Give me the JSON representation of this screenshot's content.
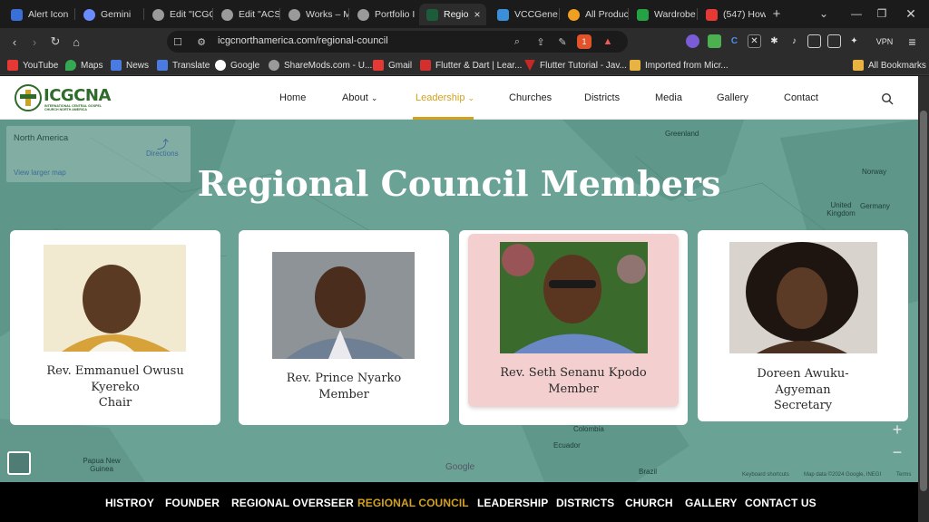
{
  "browser": {
    "tabs": [
      {
        "label": "Alert Icon",
        "icon_color": "#3b6fd8"
      },
      {
        "label": "Gemini",
        "icon_color": "#6a8cff"
      },
      {
        "label": "Edit \"ICGC",
        "icon_color": "#9a9a9a"
      },
      {
        "label": "Edit \"ACSI",
        "icon_color": "#9a9a9a"
      },
      {
        "label": "Works – M",
        "icon_color": "#9a9a9a"
      },
      {
        "label": "Portfolio I",
        "icon_color": "#9a9a9a"
      },
      {
        "label": "Regio",
        "icon_color": "#1d5c3a"
      },
      {
        "label": "VCCGene",
        "icon_color": "#3a8fd8"
      },
      {
        "label": "All Produc",
        "icon_color": "#f0a020"
      },
      {
        "label": "Wardrobe",
        "icon_color": "#25a244"
      },
      {
        "label": "(547) How",
        "icon_color": "#e53935"
      }
    ],
    "active_tab_close": "×",
    "new_tab": "+",
    "url": "icgcnorthamerica.com/regional-council",
    "brave_badge": "1",
    "vpn_label": "VPN",
    "bookmarks": [
      {
        "label": "YouTube",
        "icon_color": "#e53935"
      },
      {
        "label": "Maps",
        "icon_color": "#34a853"
      },
      {
        "label": "News",
        "icon_color": "#4a7be0"
      },
      {
        "label": "Translate",
        "icon_color": "#4a7be0"
      },
      {
        "label": "Google",
        "icon_color": "#ffffff"
      },
      {
        "label": "ShareMods.com - U...",
        "icon_color": "#9a9a9a"
      },
      {
        "label": "Gmail",
        "icon_color": "#e53935"
      },
      {
        "label": "Flutter & Dart | Lear...",
        "icon_color": "#d32f2f"
      },
      {
        "label": "Flutter Tutorial - Jav...",
        "icon_color": "#c62828"
      },
      {
        "label": "Imported from Micr...",
        "icon_color": "#e8b341"
      }
    ],
    "all_bookmarks": "All Bookmarks"
  },
  "site": {
    "logo_text": "ICGCNA",
    "logo_sub": "INTERNATIONAL CENTRAL GOSPEL CHURCH NORTH AMERICA",
    "menu": [
      {
        "label": "Home"
      },
      {
        "label": "About",
        "caret": "⌄"
      },
      {
        "label": "Leadership",
        "caret": "⌄"
      },
      {
        "label": "Churches"
      },
      {
        "label": "Districts"
      },
      {
        "label": "Media"
      },
      {
        "label": "Gallery"
      },
      {
        "label": "Contact"
      }
    ],
    "accent_color": "#d3a11d"
  },
  "map": {
    "info_title": "North America",
    "directions": "Directions",
    "larger_map": "View larger map",
    "labels": [
      "Greenland",
      "Norway",
      "United Kingdom",
      "Germany",
      "Colombia",
      "Ecuador",
      "Brazil",
      "Papua New Guinea",
      "Google",
      "Keyboard shortcuts",
      "Map data ©2024 Google, INEGI",
      "Terms"
    ],
    "zoom_in": "+",
    "zoom_out": "−"
  },
  "hero": {
    "title": "Regional Council Members"
  },
  "members": [
    {
      "name": "Rev. Emmanuel Owusu Kyereko",
      "lines": [
        "Rev. Emmanuel Owusu",
        "Kyereko",
        "Chair"
      ]
    },
    {
      "name": "Rev. Prince Nyarko",
      "lines": [
        "Rev. Prince Nyarko",
        "Member"
      ]
    },
    {
      "name": "Rev. Seth Senanu Kpodo",
      "lines": [
        "Rev. Seth Senanu Kpodo",
        "Member"
      ]
    },
    {
      "name": "Doreen Awuku-Agyeman",
      "lines": [
        "Doreen Awuku-",
        "Agyeman",
        "Secretary"
      ]
    }
  ],
  "footer_nav": [
    {
      "label": "HISTROY"
    },
    {
      "label": "FOUNDER"
    },
    {
      "label": "REGIONAL OVERSEER"
    },
    {
      "label": "REGIONAL COUNCIL"
    },
    {
      "label": "LEADERSHIP"
    },
    {
      "label": "DISTRICTS"
    },
    {
      "label": "CHURCH"
    },
    {
      "label": "GALLERY"
    },
    {
      "label": "CONTACT US"
    }
  ]
}
